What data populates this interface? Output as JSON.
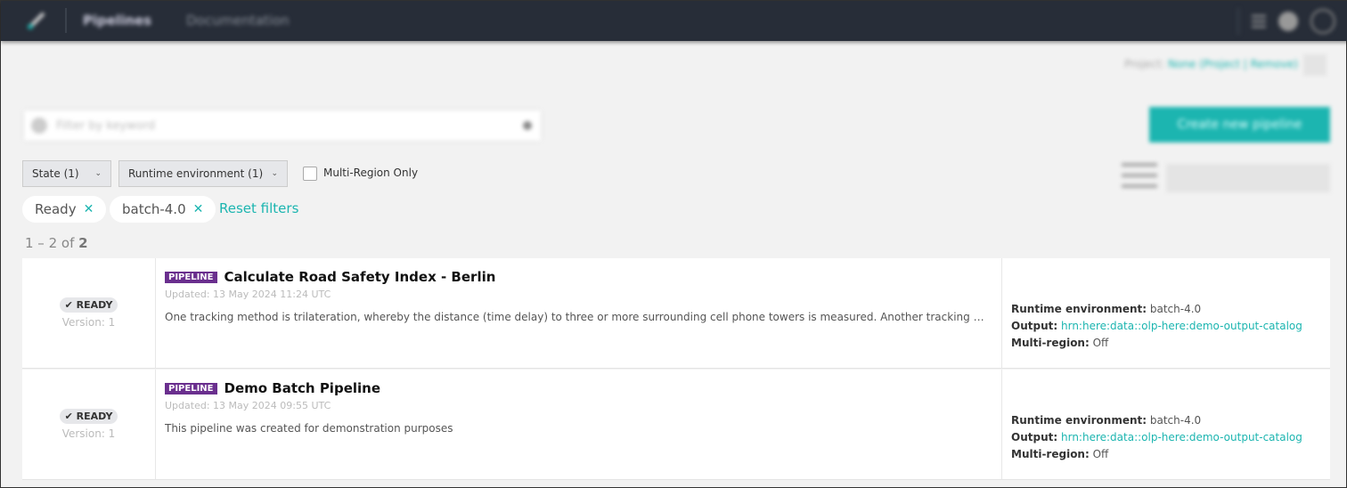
{
  "header": {
    "nav_pipelines": "Pipelines",
    "nav_documentation": "Documentation"
  },
  "toolbar": {
    "search_placeholder": "Filter by keyword",
    "create_label": "Create new pipeline"
  },
  "filters": {
    "state": "State (1)",
    "runtime": "Runtime environment (1)",
    "multi_region": "Multi-Region Only",
    "chips": [
      "Ready",
      "batch-4.0"
    ],
    "chip_close": "✕",
    "reset": "Reset filters"
  },
  "count": {
    "range": "1 – 2 of ",
    "total": "2"
  },
  "pipelines": [
    {
      "state": "✔ READY",
      "version": "Version: 1",
      "tag": "PIPELINE",
      "name": "Calculate Road Safety Index - Berlin",
      "updated": "Updated: 13 May 2024 11:24 UTC",
      "description": "One tracking method is trilateration, whereby the distance (time delay) to three or more surrounding cell phone towers is measured. Another tracking method uses GPS signals",
      "runtime_label": "Runtime environment:",
      "runtime": "batch-4.0",
      "output_label": "Output:",
      "output": "hrn:here:data::olp-here:demo-output-catalog",
      "multiregion_label": "Multi-region:",
      "multiregion": "Off"
    },
    {
      "state": "✔ READY",
      "version": "Version: 1",
      "tag": "PIPELINE",
      "name": "Demo Batch Pipeline",
      "updated": "Updated: 13 May 2024 09:55 UTC",
      "description": "This pipeline was created for demonstration purposes",
      "runtime_label": "Runtime environment:",
      "runtime": "batch-4.0",
      "output_label": "Output:",
      "output": "hrn:here:data::olp-here:demo-output-catalog",
      "multiregion_label": "Multi-region:",
      "multiregion": "Off"
    }
  ]
}
